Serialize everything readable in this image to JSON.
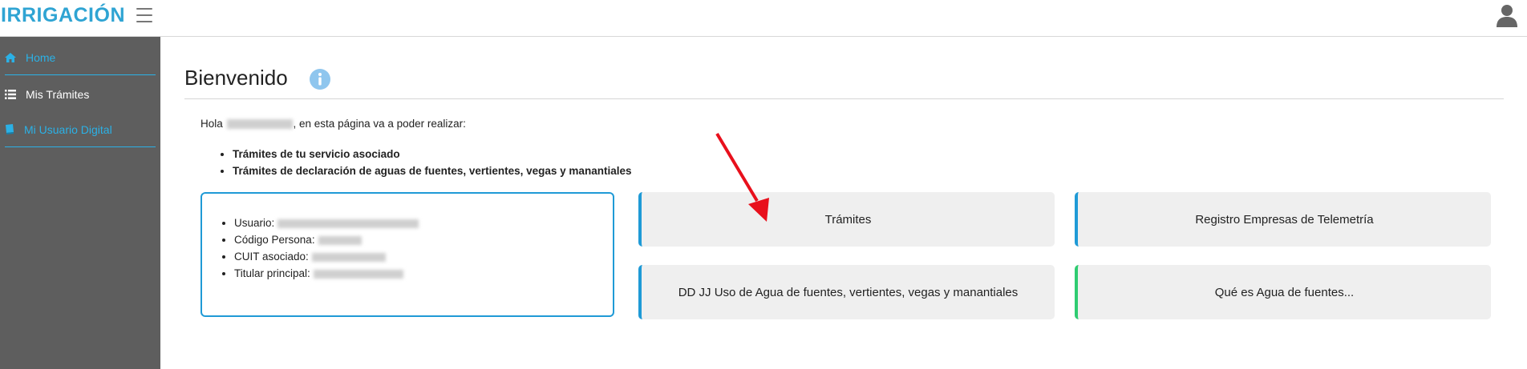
{
  "header": {
    "logo_text": "IRRIGACIÓN",
    "menu_icon": "hamburger-icon",
    "user_icon": "user-avatar-icon"
  },
  "sidebar": {
    "items": [
      {
        "label": "Home",
        "icon": "home-icon",
        "color": "#2bb1e6"
      },
      {
        "label": "Mis Trámites",
        "icon": "list-icon",
        "color": "#ffffff"
      },
      {
        "label": "Mi Usuario Digital",
        "icon": "book-icon",
        "color": "#2bb1e6"
      }
    ]
  },
  "main": {
    "title": "Bienvenido",
    "intro_prefix": "Hola",
    "intro_suffix": ", en esta página va a poder realizar:",
    "bullets": [
      "Trámites de tu servicio asociado",
      "Trámites de declaración de aguas de fuentes, vertientes, vegas y manantiales"
    ],
    "user_info": {
      "usuario_label": "Usuario:",
      "codigo_label": "Código Persona:",
      "cuit_label": "CUIT asociado:",
      "titular_label": "Titular principal:"
    },
    "cards": {
      "tramites": "Trámites",
      "telemetria": "Registro Empresas de Telemetría",
      "ddjj": "DD JJ Uso de Agua de fuentes, vertientes, vegas y manantiales",
      "que_es": "Qué es Agua de fuentes..."
    }
  },
  "colors": {
    "accent": "#1f9ad6",
    "sidebar_bg": "#5e5e5e",
    "card_bg": "#efefef",
    "green_accent": "#2ecc71",
    "arrow": "#e8101c"
  }
}
